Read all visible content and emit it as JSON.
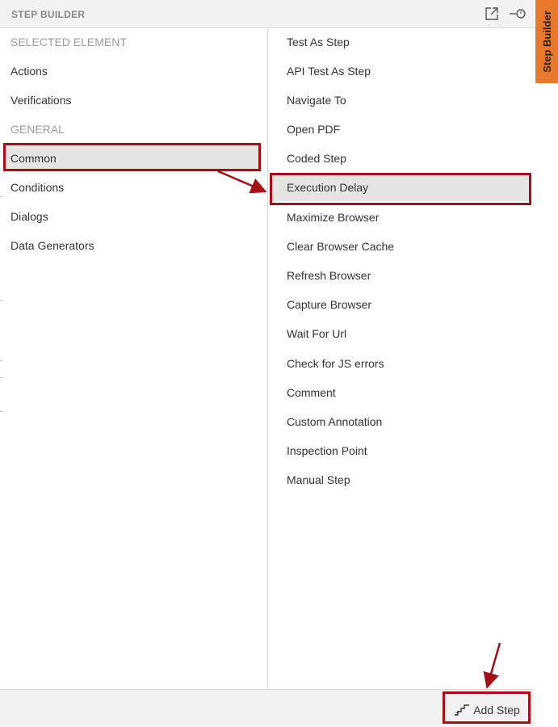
{
  "header": {
    "title": "STEP BUILDER",
    "popout_icon": "external-window-icon",
    "pin_icon": "pin-icon"
  },
  "left_list": {
    "items": [
      {
        "label": "SELECTED ELEMENT",
        "kind": "section"
      },
      {
        "label": "Actions",
        "kind": "item"
      },
      {
        "label": "Verifications",
        "kind": "item"
      },
      {
        "label": "GENERAL",
        "kind": "section"
      },
      {
        "label": "Common",
        "kind": "item",
        "selected": true
      },
      {
        "label": "Conditions",
        "kind": "item"
      },
      {
        "label": "Dialogs",
        "kind": "item"
      },
      {
        "label": "Data Generators",
        "kind": "item"
      }
    ]
  },
  "right_list": {
    "items": [
      {
        "label": "Test As Step"
      },
      {
        "label": "API Test As Step"
      },
      {
        "label": "Navigate To"
      },
      {
        "label": "Open PDF"
      },
      {
        "label": "Coded Step"
      },
      {
        "label": "Execution Delay",
        "selected": true
      },
      {
        "label": "Maximize Browser"
      },
      {
        "label": "Clear Browser Cache"
      },
      {
        "label": "Refresh Browser"
      },
      {
        "label": "Capture Browser"
      },
      {
        "label": "Wait For Url"
      },
      {
        "label": "Check for JS errors"
      },
      {
        "label": "Comment"
      },
      {
        "label": "Custom Annotation"
      },
      {
        "label": "Inspection Point"
      },
      {
        "label": "Manual Step"
      }
    ]
  },
  "footer": {
    "add_step_label": "Add Step",
    "add_step_icon": "steps-icon"
  },
  "side_tab": {
    "label": "Step Builder"
  },
  "colors": {
    "accent_orange": "#e8792b",
    "highlight_red": "#a50f15",
    "selection_gray": "#e5e5e5",
    "section_gray": "#9b9b9b",
    "chrome_gray": "#f2f2f2"
  }
}
